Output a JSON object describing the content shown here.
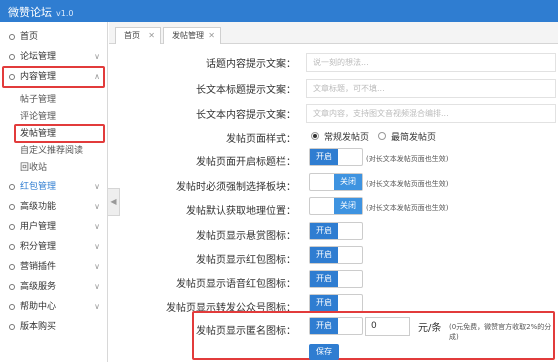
{
  "header": {
    "app_title": "微赞论坛",
    "version": "v1.0",
    "bg_color": "#2f7dd1"
  },
  "sidebar": {
    "items": [
      {
        "label": "首页",
        "chevron": ""
      },
      {
        "label": "论坛管理",
        "chevron": "∨"
      },
      {
        "label": "内容管理",
        "chevron": "∧"
      },
      {
        "label": "红包管理",
        "chevron": "∨"
      },
      {
        "label": "高级功能",
        "chevron": "∨"
      },
      {
        "label": "用户管理",
        "chevron": "∨"
      },
      {
        "label": "积分管理",
        "chevron": "∨"
      },
      {
        "label": "营销插件",
        "chevron": "∨"
      },
      {
        "label": "高级服务",
        "chevron": "∨"
      },
      {
        "label": "帮助中心",
        "chevron": "∨"
      },
      {
        "label": "版本购买",
        "chevron": ""
      }
    ],
    "sub_items": [
      "帖子管理",
      "评论管理",
      "发帖管理",
      "自定义推荐阅读",
      "回收站"
    ],
    "collapse_glyph": "◀"
  },
  "tabs": [
    {
      "label": "首页",
      "close": "✕"
    },
    {
      "label": "发帖管理",
      "close": "✕"
    }
  ],
  "form": {
    "topic_hint_label": "话题内容提示文案：",
    "topic_hint_placeholder": "说一刻的想法...",
    "long_title_label": "长文本标题提示文案：",
    "long_title_placeholder": "文章标题，可不填...",
    "long_content_label": "长文本内容提示文案：",
    "long_content_placeholder": "文章内容，支持图文音视频混合编排...",
    "style_label": "发帖页面样式：",
    "style_options": [
      "常规发帖页",
      "最简发帖页"
    ],
    "title_bar_label": "发帖页面开启标题栏：",
    "title_bar_toggle": "开启",
    "title_bar_hint": "(对长文本发帖页面也生效)",
    "force_section_label": "发帖时必须强制选择板块：",
    "force_section_toggle": "关闭",
    "force_section_hint": "(对长文本发帖页面也生效)",
    "location_label": "发帖默认获取地理位置：",
    "location_toggle": "关闭",
    "location_hint": "(对长文本发帖页面也生效)",
    "reward_icon_label": "发帖页显示悬赏图标：",
    "reward_icon_toggle": "开启",
    "redpacket_icon_label": "发帖页显示红包图标：",
    "redpacket_icon_toggle": "开启",
    "voice_redpacket_label": "发帖页显示语音红包图标：",
    "voice_redpacket_toggle": "开启",
    "repost_label": "发帖页显示转发公众号图标：",
    "repost_toggle": "开启",
    "anon_label": "发帖页显示匿名图标：",
    "anon_toggle": "开启",
    "anon_price": "0",
    "anon_unit": "元/条",
    "anon_hint": "(0元免费，微赞官方收取2%的分成)",
    "save_label": "保存"
  },
  "colors": {
    "accent": "#2f7dd1",
    "highlight_box": "#e23b3b"
  }
}
